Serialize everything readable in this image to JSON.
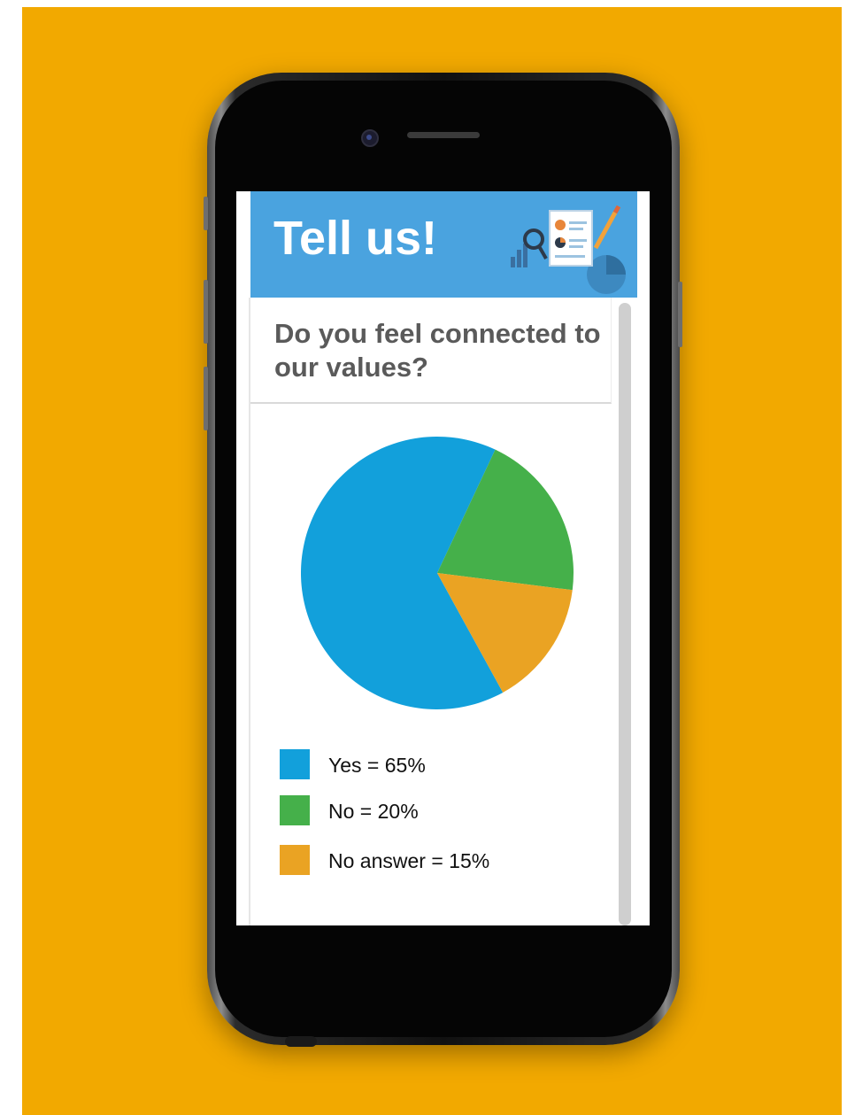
{
  "background_color": "#f2a900",
  "header": {
    "title": "Tell us!",
    "color": "#4aa3df",
    "icon": "survey-report-icon"
  },
  "question": "Do you feel connected to our values?",
  "chart_data": {
    "type": "pie",
    "categories": [
      "Yes",
      "No",
      "No answer"
    ],
    "values": [
      65,
      20,
      15
    ],
    "colors": [
      "#12a0db",
      "#45b04a",
      "#eaa323"
    ],
    "legend": [
      "Yes = 65%",
      "No = 20%",
      "No answer = 15%"
    ],
    "legend_placement": "bottom"
  }
}
